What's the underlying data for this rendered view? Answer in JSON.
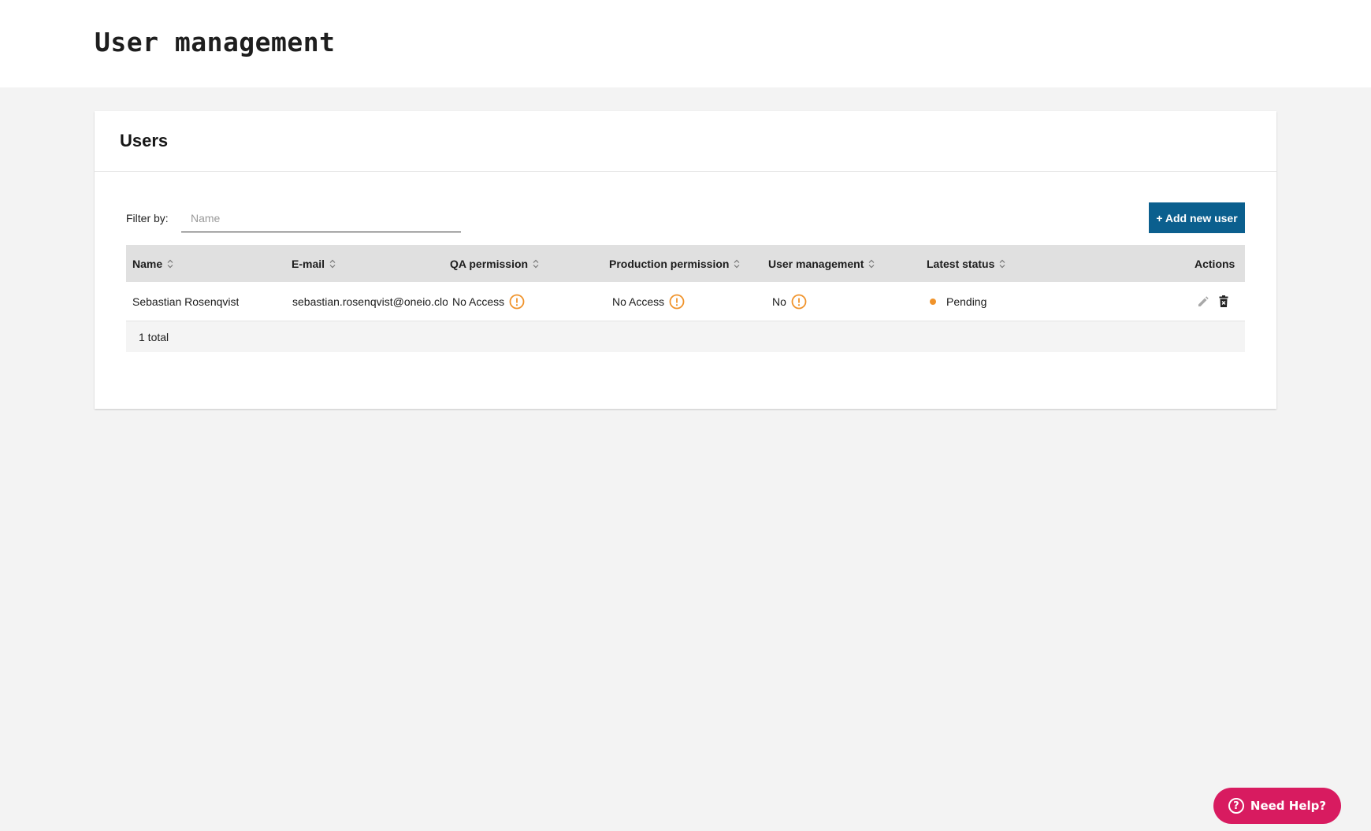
{
  "page": {
    "title": "User management"
  },
  "card": {
    "title": "Users",
    "filter_label": "Filter by:",
    "filter_placeholder": "Name",
    "filter_value": "",
    "add_button_label": "+ Add new user"
  },
  "table": {
    "columns": [
      {
        "label": "Name",
        "sortable": true
      },
      {
        "label": "E-mail",
        "sortable": true
      },
      {
        "label": "QA permission",
        "sortable": true
      },
      {
        "label": "Production permission",
        "sortable": true
      },
      {
        "label": "User management",
        "sortable": true
      },
      {
        "label": "Latest status",
        "sortable": true
      },
      {
        "label": "Actions",
        "sortable": false
      }
    ],
    "rows": [
      {
        "name": "Sebastian Rosenqvist",
        "email": "sebastian.rosenqvist@oneio.cloud",
        "qa_permission": "No Access",
        "production_permission": "No Access",
        "user_management": "No",
        "latest_status": "Pending"
      }
    ],
    "footer_total": "1 total"
  },
  "help": {
    "label": "Need Help?",
    "icon": "question-icon"
  },
  "colors": {
    "accent": "#0b5f8e",
    "warning": "#f0932b",
    "help": "#d81b60"
  }
}
